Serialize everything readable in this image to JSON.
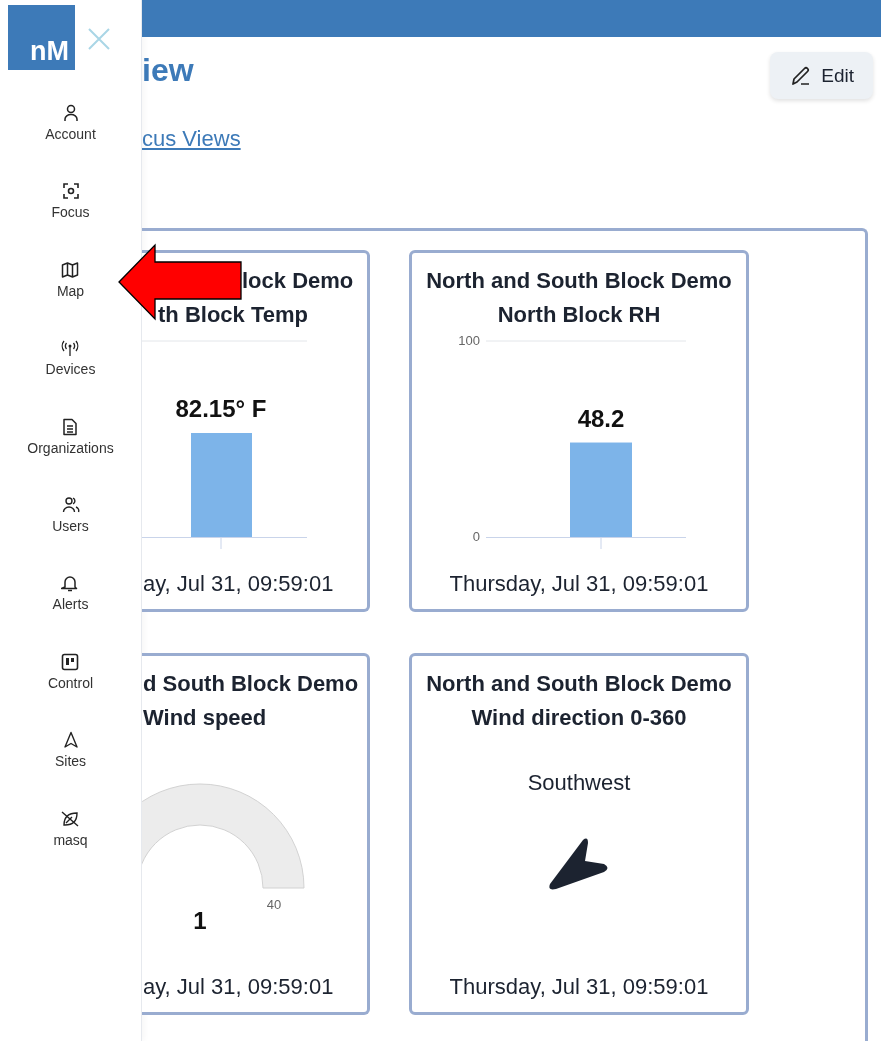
{
  "sidebar": {
    "logo": "nM",
    "items": [
      {
        "label": "Account"
      },
      {
        "label": "Focus"
      },
      {
        "label": "Map"
      },
      {
        "label": "Devices"
      },
      {
        "label": "Organizations"
      },
      {
        "label": "Users"
      },
      {
        "label": "Alerts"
      },
      {
        "label": "Control"
      },
      {
        "label": "Sites"
      },
      {
        "label": "masq"
      }
    ]
  },
  "page": {
    "title": "iew",
    "link": "cus Views",
    "edit_button": "Edit"
  },
  "cards": [
    {
      "kind": "bar",
      "title_lines": [
        "lock Demo",
        "th Block Temp"
      ],
      "reading": "82.15° F",
      "timestamp": "ay, Jul 31, 09:59:01"
    },
    {
      "kind": "bar_axis",
      "title_lines": [
        "North and South Block Demo",
        "North Block RH"
      ],
      "timestamp": "Thursday, Jul 31, 09:59:01",
      "chart_data": {
        "type": "bar",
        "values": [
          48.2
        ],
        "ylim": [
          0,
          100
        ],
        "yticks": [
          {
            "value": 0,
            "label": "0"
          },
          {
            "value": 100,
            "label": "100"
          }
        ],
        "value_labels": [
          "48.2"
        ]
      }
    },
    {
      "kind": "gauge",
      "title_lines": [
        "d South Block Demo",
        "Wind speed"
      ],
      "reading": "1",
      "max_label": "40",
      "timestamp": "ay, Jul 31, 09:59:01"
    },
    {
      "kind": "direction",
      "title_lines": [
        "North and South Block Demo",
        "Wind direction 0-360"
      ],
      "reading": "Southwest",
      "timestamp": "Thursday, Jul 31, 09:59:01"
    }
  ]
}
